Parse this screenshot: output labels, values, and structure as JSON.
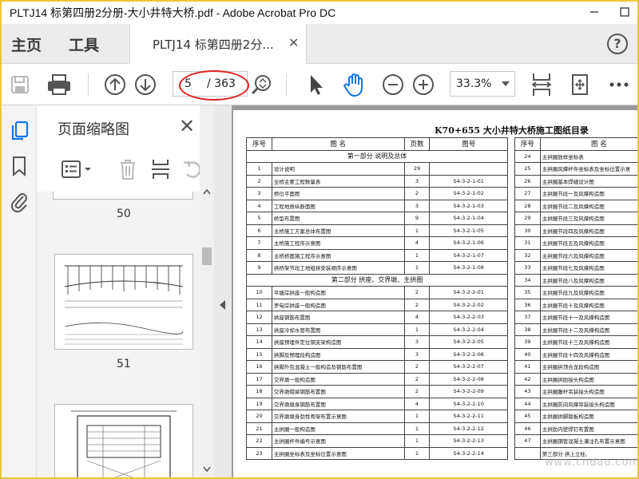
{
  "window": {
    "title": "PLTJ14 标第四册2分册-大小井特大桥.pdf - Adobe Acrobat Pro DC"
  },
  "nav": {
    "home": "主页",
    "tools": "工具"
  },
  "tab": {
    "label": "PLTJ14 标第四册2分..."
  },
  "toolbar": {
    "current_page": "5",
    "total_pages": "/ 363",
    "zoom": "33.3%"
  },
  "panel": {
    "title": "页面缩略图",
    "thumbnails": [
      {
        "label": "50"
      },
      {
        "label": "51"
      }
    ]
  },
  "document": {
    "title": "K70+655  大小井特大桥施工图纸目录",
    "left_table": {
      "headers": [
        "序号",
        "图    名",
        "页数",
        "图号"
      ],
      "rows": [
        {
          "section": "第一部分  说明及总体"
        },
        {
          "no": "1",
          "name": "设计说明",
          "pages": "29",
          "code": ""
        },
        {
          "no": "2",
          "name": "全桥主要工程数量表",
          "pages": "3",
          "code": "S4-3-2-1-01"
        },
        {
          "no": "3",
          "name": "桥位平面图",
          "pages": "2",
          "code": "S4-3-2-1-02"
        },
        {
          "no": "4",
          "name": "工程地质纵断面图",
          "pages": "3",
          "code": "S4-3-2-1-03"
        },
        {
          "no": "5",
          "name": "桥型布置图",
          "pages": "9",
          "code": "S4-3-2-1-04"
        },
        {
          "no": "6",
          "name": "主桥施工方案总体布置图",
          "pages": "1",
          "code": "S4-3-2-1-05"
        },
        {
          "no": "7",
          "name": "主桥施工程序示意图",
          "pages": "4",
          "code": "S4-3-2-1-06"
        },
        {
          "no": "8",
          "name": "主桥桥面施工程序示意图",
          "pages": "1",
          "code": "S4-3-2-1-07"
        },
        {
          "no": "9",
          "name": "拱桥架节段工地组拼安装顺序示意图",
          "pages": "1",
          "code": "S4-3-2-1-08"
        },
        {
          "section": "第二部分  拱座、交界墩、主拱圈"
        },
        {
          "no": "10",
          "name": "平塘岸拱座一般构造图",
          "pages": "2",
          "code": "S4-3-2-2-01"
        },
        {
          "no": "11",
          "name": "罗甸岸拱座一般构造图",
          "pages": "2",
          "code": "S4-3-2-2-02"
        },
        {
          "no": "12",
          "name": "拱座钢筋布置图",
          "pages": "4",
          "code": "S4-3-2-2-03"
        },
        {
          "no": "13",
          "name": "拱座冷却水管布置图",
          "pages": "1",
          "code": "S4-3-2-2-04"
        },
        {
          "no": "14",
          "name": "拱座预埋件定位钢支架构造图",
          "pages": "3",
          "code": "S4-3-2-2-05"
        },
        {
          "no": "15",
          "name": "拱脚及预埋段构造图",
          "pages": "3",
          "code": "S4-3-2-2-06"
        },
        {
          "no": "16",
          "name": "拱脚外包混凝土一般构造及钢筋布置图",
          "pages": "2",
          "code": "S4-3-2-2-07"
        },
        {
          "no": "17",
          "name": "交界墩一般构造图",
          "pages": "2",
          "code": "S4-3-2-2-08"
        },
        {
          "no": "18",
          "name": "交界墩帽梁钢筋布置图",
          "pages": "2",
          "code": "S4-3-2-2-09"
        },
        {
          "no": "19",
          "name": "交界墩墩身钢筋布置图",
          "pages": "4",
          "code": "S4-3-2-2-10"
        },
        {
          "no": "20",
          "name": "交界墩墩身劲性骨架布置示意图",
          "pages": "1",
          "code": "S4-3-2-2-11"
        },
        {
          "no": "21",
          "name": "主拱圈一般构造图",
          "pages": "1",
          "code": "S4-3-2-2-12"
        },
        {
          "no": "22",
          "name": "主拱圈杆件编号示意图",
          "pages": "1",
          "code": "S4-3-2-2-13"
        },
        {
          "no": "23",
          "name": "主拱圈坐标表及坐标位置示意图",
          "pages": "1",
          "code": "S4-3-2-2-14"
        }
      ]
    },
    "right_table": {
      "headers": [
        "序号",
        "图    名"
      ],
      "rows": [
        {
          "no": "24",
          "name": "主拱圈放样坐标表"
        },
        {
          "no": "25",
          "name": "主拱圈风撑杆件坐标表及坐标位置示意"
        },
        {
          "no": "26",
          "name": "主拱圈基本焊缝设计图"
        },
        {
          "no": "27",
          "name": "主拱圈节段一及风撑构造图"
        },
        {
          "no": "28",
          "name": "主拱圈节段二及风撑构造图"
        },
        {
          "no": "29",
          "name": "主拱圈节段三及风撑构造图"
        },
        {
          "no": "30",
          "name": "主拱圈节段四及风撑构造图"
        },
        {
          "no": "31",
          "name": "主拱圈节段五及风撑构造图"
        },
        {
          "no": "32",
          "name": "主拱圈节段六及风撑构造图"
        },
        {
          "no": "33",
          "name": "主拱圈节段七及风撑构造图"
        },
        {
          "no": "34",
          "name": "主拱圈节段八及风撑构造图"
        },
        {
          "no": "35",
          "name": "主拱圈节段九及风撑构造图"
        },
        {
          "no": "36",
          "name": "主拱圈节段十及风撑构造图"
        },
        {
          "no": "37",
          "name": "主拱圈节段十一及风撑构造图"
        },
        {
          "no": "38",
          "name": "主拱圈节段十二及风撑构造图"
        },
        {
          "no": "39",
          "name": "主拱圈节段十三及风撑构造图"
        },
        {
          "no": "40",
          "name": "主拱圈节段十四及风撑构造图"
        },
        {
          "no": "41",
          "name": "主拱圈拱顶合龙段构造图"
        },
        {
          "no": "42",
          "name": "主拱圈拱肋接头构造图"
        },
        {
          "no": "43",
          "name": "主拱圈腹杆吊装接头构造图"
        },
        {
          "no": "44",
          "name": "主拱圈防间风撑吊装接头构造图"
        },
        {
          "no": "45",
          "name": "主拱圈拱脚锻板构造图"
        },
        {
          "no": "46",
          "name": "主拱肋内壁焊钉布置图"
        },
        {
          "no": "47",
          "name": "主拱圈钢管混凝土灌注孔布置示意图"
        },
        {
          "no": "",
          "name": "第三部分  拱上立柱、"
        }
      ]
    }
  },
  "watermark": "www.cndao.com"
}
